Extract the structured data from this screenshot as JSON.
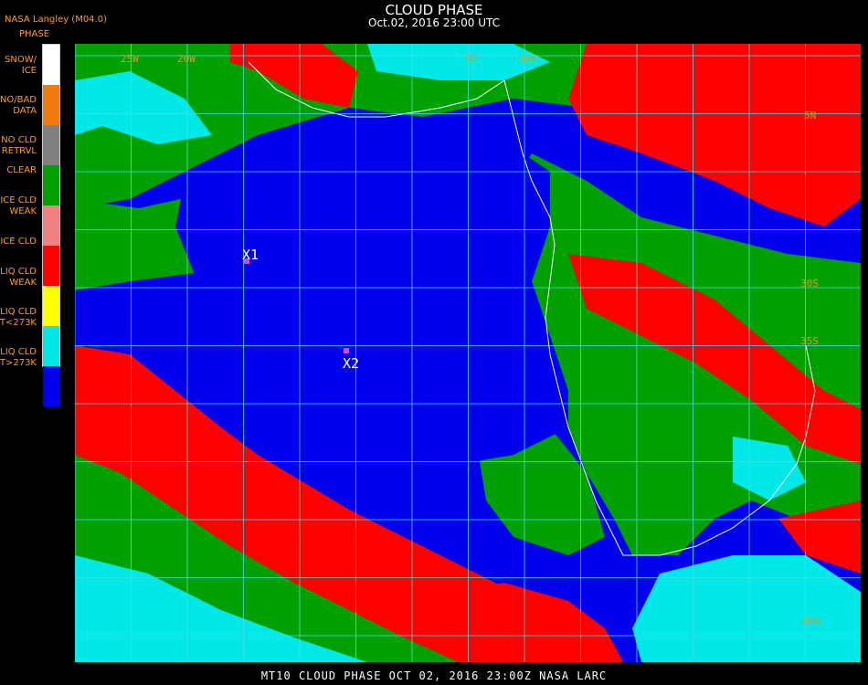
{
  "header": {
    "title": "CLOUD PHASE",
    "timestamp": "Oct.02, 2016 23:00 UTC",
    "producer": "NASA Langley (M04.0)"
  },
  "legend": {
    "heading": "PHASE",
    "items": [
      {
        "label": "SNOW/\nICE",
        "color": "#ffffff"
      },
      {
        "label": "NO/BAD\nDATA",
        "color": "#f07c10"
      },
      {
        "label": "NO CLD\nRETRVL",
        "color": "#808080"
      },
      {
        "label": "CLEAR",
        "color": "#00a000"
      },
      {
        "label": "ICE CLD\nWEAK",
        "color": "#f08080"
      },
      {
        "label": "ICE CLD",
        "color": "#ff0000"
      },
      {
        "label": "LIQ CLD\nWEAK",
        "color": "#ffff00"
      },
      {
        "label": "LIQ CLD\nT<273K",
        "color": "#00e8e8"
      },
      {
        "label": "LIQ CLD\nT>273K",
        "color": "#0000ee"
      }
    ]
  },
  "map": {
    "markers": [
      {
        "label": "X1",
        "color": "#e040e0"
      },
      {
        "label": "X2",
        "color": "#e040e0"
      }
    ],
    "grid_labels": {
      "longitudes": [
        "25W",
        "20W",
        "5E",
        "10E"
      ],
      "latitudes": [
        "5N",
        "30S",
        "35S",
        "40S"
      ]
    },
    "grid_color": "#40e0e0"
  },
  "footer": {
    "text": "MT10  CLOUD PHASE   OCT 02, 2016 23:00Z   NASA LARC"
  }
}
